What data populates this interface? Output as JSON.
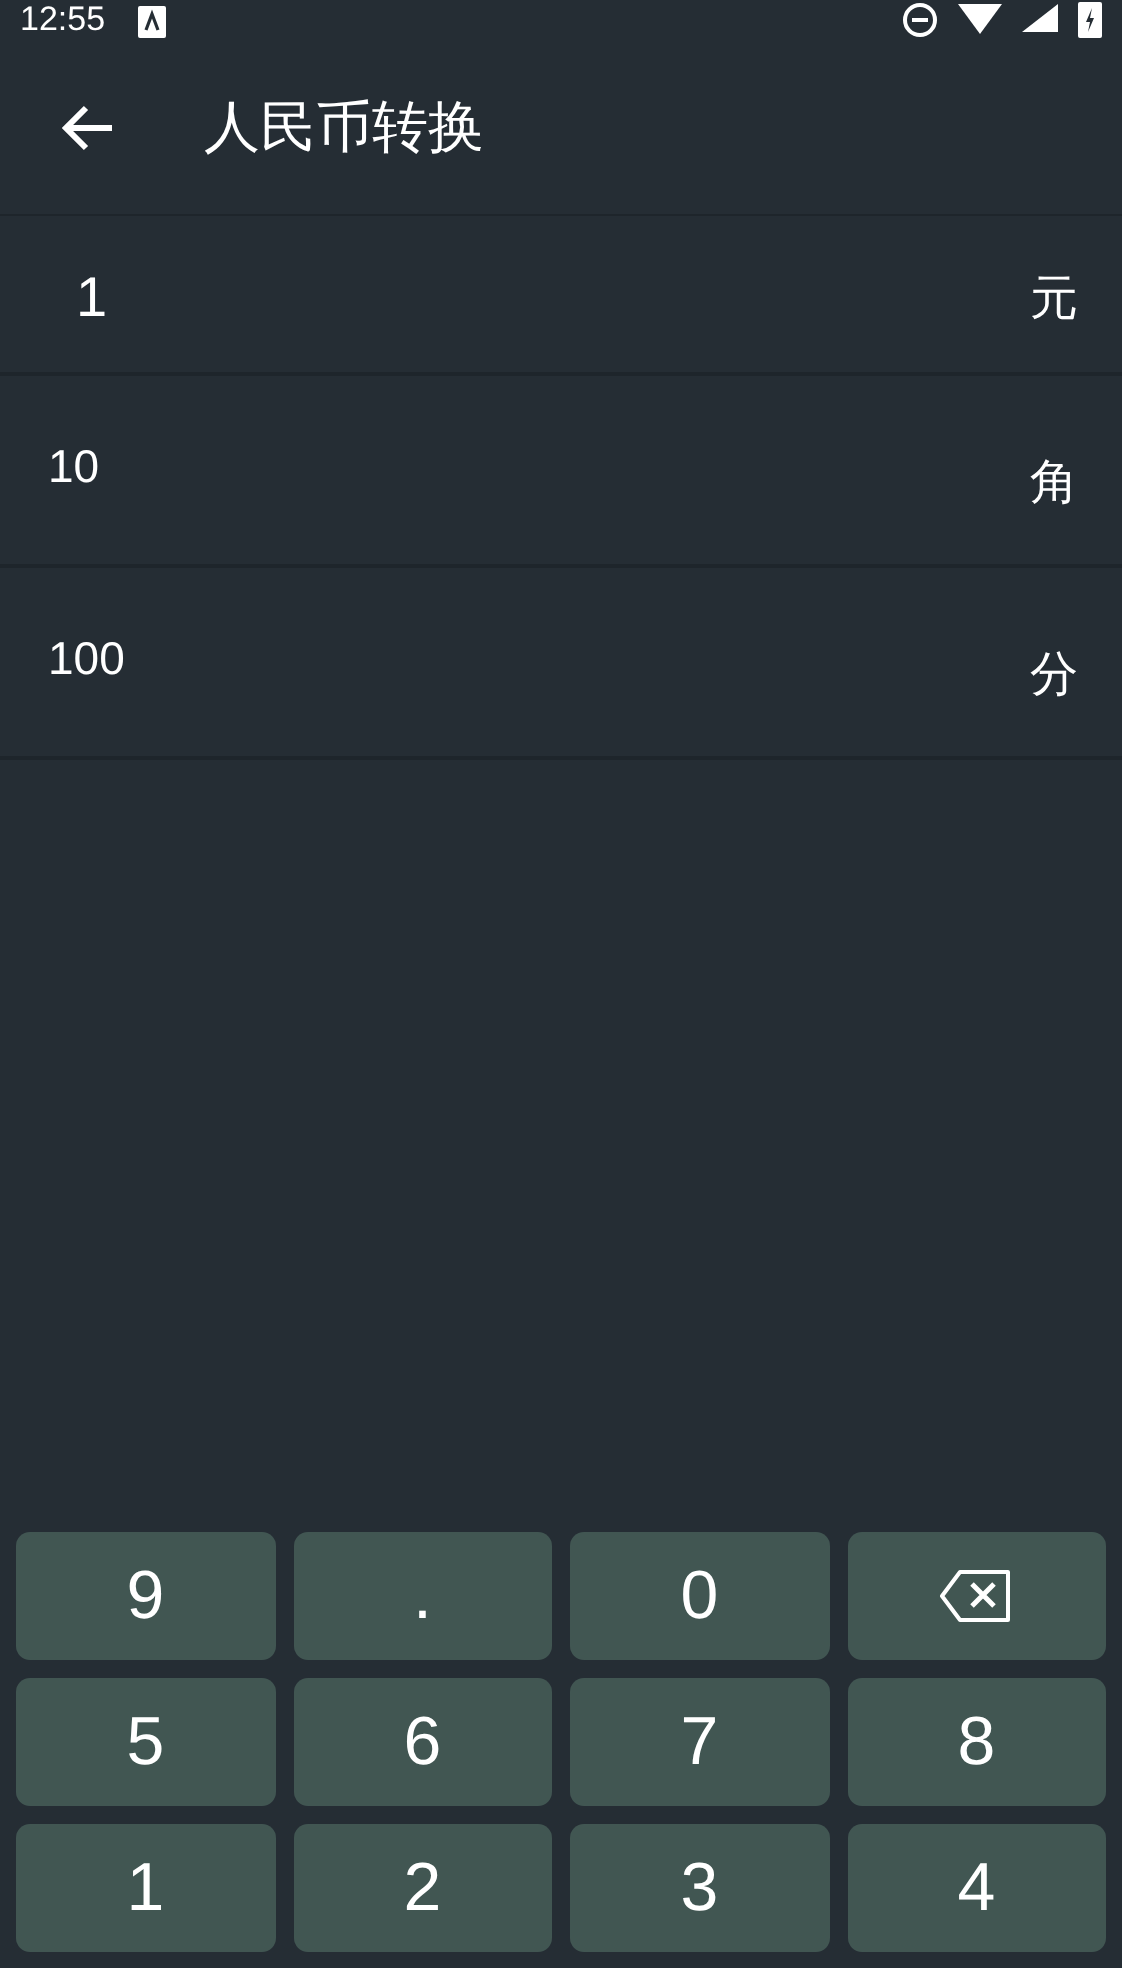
{
  "status_bar": {
    "time": "12:55"
  },
  "app_bar": {
    "title": "人民币转换"
  },
  "rows": [
    {
      "value": "1",
      "unit": "元",
      "selected": true
    },
    {
      "value": "10",
      "unit": "角",
      "selected": false
    },
    {
      "value": "100",
      "unit": "分",
      "selected": false
    }
  ],
  "keypad": [
    {
      "kind": "key",
      "label": "9"
    },
    {
      "kind": "key",
      "label": "."
    },
    {
      "kind": "key",
      "label": "0"
    },
    {
      "kind": "backspace"
    },
    {
      "kind": "key",
      "label": "5"
    },
    {
      "kind": "key",
      "label": "6"
    },
    {
      "kind": "key",
      "label": "7"
    },
    {
      "kind": "key",
      "label": "8"
    },
    {
      "kind": "key",
      "label": "1"
    },
    {
      "kind": "key",
      "label": "2"
    },
    {
      "kind": "key",
      "label": "3"
    },
    {
      "kind": "key",
      "label": "4"
    }
  ]
}
